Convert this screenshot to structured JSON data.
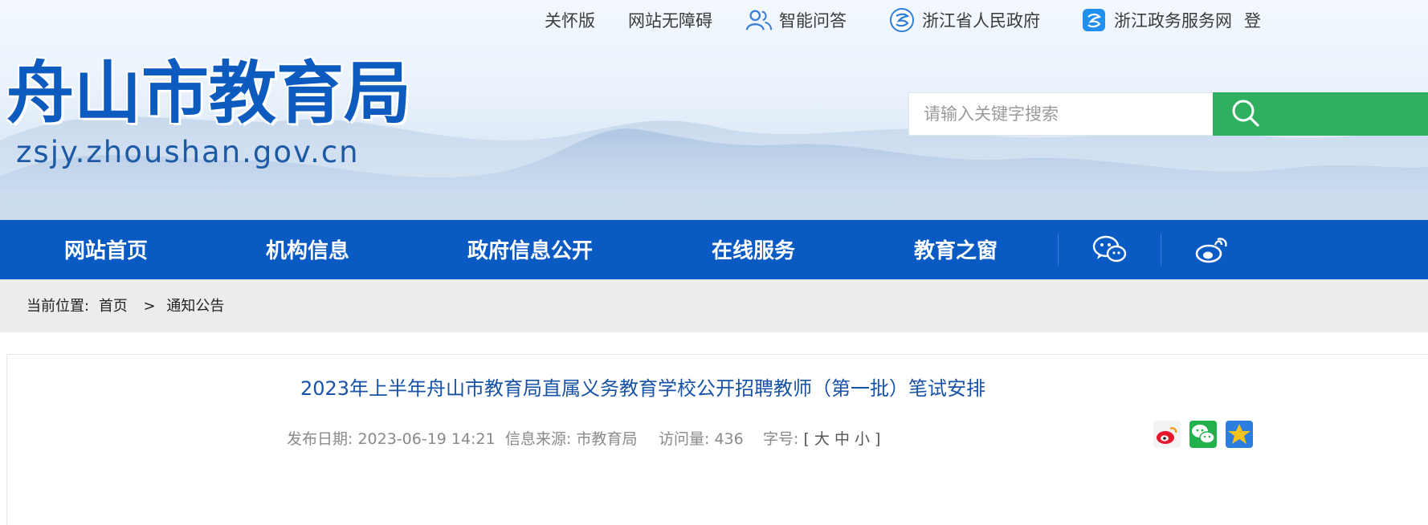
{
  "topbar": {
    "links": [
      "关怀版",
      "网站无障碍",
      "智能问答",
      "浙江省人民政府",
      "浙江政务服务网",
      "登"
    ]
  },
  "site": {
    "name_cn": "舟山市教育局",
    "domain": "zsjy.zhoushan.gov.cn"
  },
  "search": {
    "placeholder": "请输入关键字搜索"
  },
  "nav": {
    "items": [
      "网站首页",
      "机构信息",
      "政府信息公开",
      "在线服务",
      "教育之窗"
    ]
  },
  "breadcrumb": {
    "prefix": "当前位置:",
    "home": "首页",
    "separator": ">",
    "current": "通知公告"
  },
  "article": {
    "title": "2023年上半年舟山市教育局直属义务教育学校公开招聘教师（第一批）笔试安排",
    "publish_label": "发布日期:",
    "publish_date": "2023-06-19 14:21",
    "source_label": "信息来源:",
    "source": "市教育局",
    "views_label": "访问量:",
    "views": "436",
    "fontsize_label": "字号:",
    "fontsize_options": "[ 大 中 小 ]"
  },
  "colors": {
    "brand_blue": "#0a5ac4",
    "search_green": "#2fb061",
    "title_blue": "#1752a6"
  }
}
